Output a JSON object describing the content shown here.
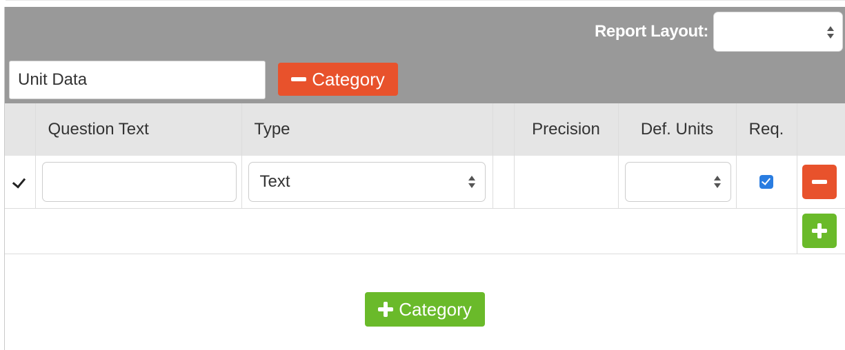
{
  "header": {
    "report_layout_label": "Report Layout:",
    "report_layout_value": ""
  },
  "category": {
    "name_value": "Unit Data",
    "remove_button_label": "Category"
  },
  "table": {
    "columns": [
      "",
      "Question Text",
      "Type",
      "",
      "Precision",
      "Def. Units",
      "Req.",
      ""
    ],
    "rows": [
      {
        "checked": true,
        "question_text": "",
        "type": "Text",
        "precision": "",
        "def_units": "",
        "required": true
      }
    ]
  },
  "footer": {
    "add_category_label": "Category"
  },
  "colors": {
    "header_bg": "#999999",
    "remove_red": "#e8522c",
    "add_green": "#6aba2a",
    "checkbox_blue": "#2a7de1"
  },
  "icons": [
    "checkmark-icon",
    "minus-icon",
    "plus-icon",
    "select-stepper-icon"
  ]
}
